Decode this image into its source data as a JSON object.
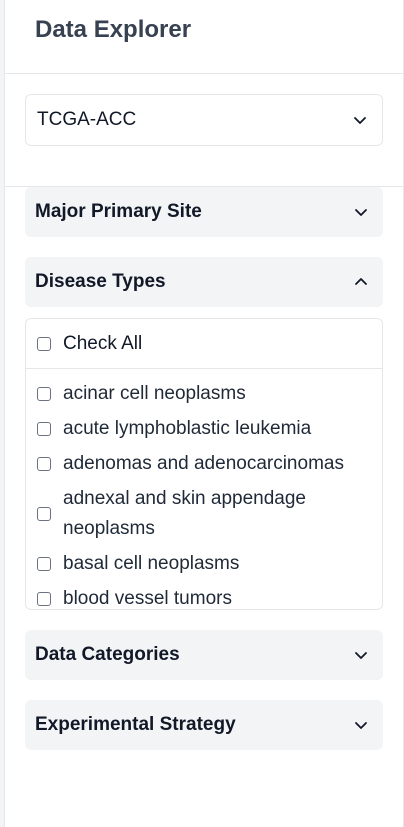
{
  "sidebar": {
    "title": "Data Explorer",
    "dataset_select": {
      "value": "TCGA-ACC"
    },
    "sections": {
      "major_primary_site": {
        "label": "Major Primary Site",
        "icon": "chevron-down-icon"
      },
      "disease_types": {
        "label": "Disease Types",
        "icon": "chevron-up-icon",
        "check_all_label": "Check All",
        "items": [
          "acinar cell neoplasms",
          "acute lymphoblastic leukemia",
          "adenomas and adenocarcinomas",
          "adnexal and skin appendage neoplasms",
          "basal cell neoplasms",
          "blood vessel tumors"
        ]
      },
      "data_categories": {
        "label": "Data Categories",
        "icon": "chevron-down-icon"
      },
      "experimental_strategy": {
        "label": "Experimental Strategy",
        "icon": "chevron-down-icon"
      }
    }
  },
  "colors": {
    "border": "#e5e7eb",
    "accordion_bg": "#f3f4f6",
    "title_text": "#374151",
    "text": "#111827"
  }
}
